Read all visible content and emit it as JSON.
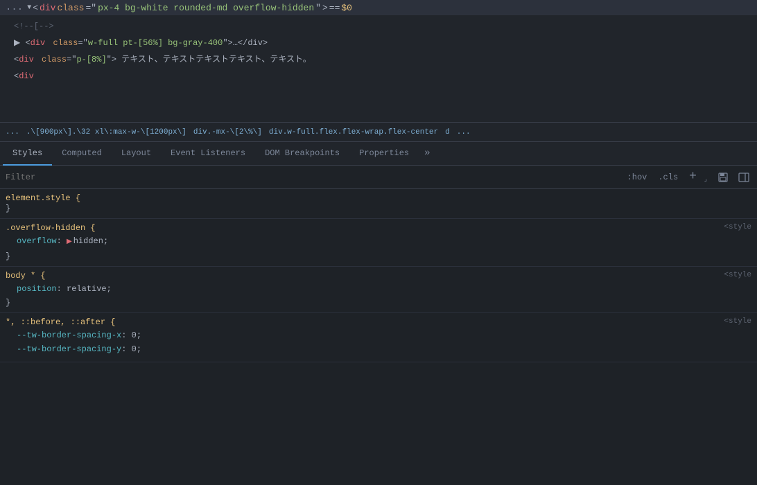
{
  "inspector": {
    "top_line": {
      "dots": "...",
      "selected_tag": "<div class=\"px-4 bg-white rounded-md overflow-hidden\">",
      "equals": "==",
      "dollar_zero": "$0"
    },
    "lines": [
      {
        "indent": 1,
        "type": "comment",
        "content": "<!--[-->"
      },
      {
        "indent": 1,
        "type": "tag",
        "expand": true,
        "tag": "div",
        "attrs": "class=\"w-full pt-[56%] bg-gray-400\"",
        "tail": "…</div>"
      },
      {
        "indent": 1,
        "type": "tag",
        "expand": false,
        "tag": "div",
        "attrs": "class=\"p-[8%]\"",
        "content": " テキスト、テキストテキストテキスト、テキスト。"
      },
      {
        "indent": 1,
        "type": "tag_partial",
        "content": "<div"
      }
    ]
  },
  "breadcrumb": {
    "items": [
      "...",
      ".\\[900px\\].\\32 xl\\:max-w-\\[1200px\\]",
      "div.-mx-\\[2\\%\\]",
      "div.w-full.flex.flex-wrap.flex-center",
      "d",
      "..."
    ]
  },
  "tabs": {
    "items": [
      {
        "label": "Styles",
        "active": true
      },
      {
        "label": "Computed",
        "active": false
      },
      {
        "label": "Layout",
        "active": false
      },
      {
        "label": "Event Listeners",
        "active": false
      },
      {
        "label": "DOM Breakpoints",
        "active": false
      },
      {
        "label": "Properties",
        "active": false
      },
      {
        "label": "»",
        "active": false
      }
    ]
  },
  "filter": {
    "placeholder": "Filter",
    "hov_label": ":hov",
    "cls_label": ".cls",
    "plus_label": "+",
    "save_icon": "💾",
    "toggle_icon": "⊡"
  },
  "css_rules": [
    {
      "selector": "element.style {",
      "source": "",
      "properties": [],
      "close": "}"
    },
    {
      "selector": ".overflow-hidden {",
      "source": "<style",
      "properties": [
        {
          "name": "overflow",
          "colon": ":",
          "value": "hidden",
          "has_swatch": true,
          "semicolon": ";"
        }
      ],
      "close": "}"
    },
    {
      "selector": "body * {",
      "source": "<style",
      "properties": [
        {
          "name": "position",
          "colon": ":",
          "value": "relative",
          "has_swatch": false,
          "semicolon": ";"
        }
      ],
      "close": "}"
    },
    {
      "selector": "*, ::before, ::after {",
      "source": "<style",
      "properties": [
        {
          "name": "--tw-border-spacing-x",
          "colon": ":",
          "value": "0",
          "has_swatch": false,
          "semicolon": ";"
        },
        {
          "name": "--tw-border-spacing-y",
          "colon": ":",
          "value": "0",
          "has_swatch": false,
          "semicolon": ";"
        }
      ],
      "close": ""
    }
  ]
}
